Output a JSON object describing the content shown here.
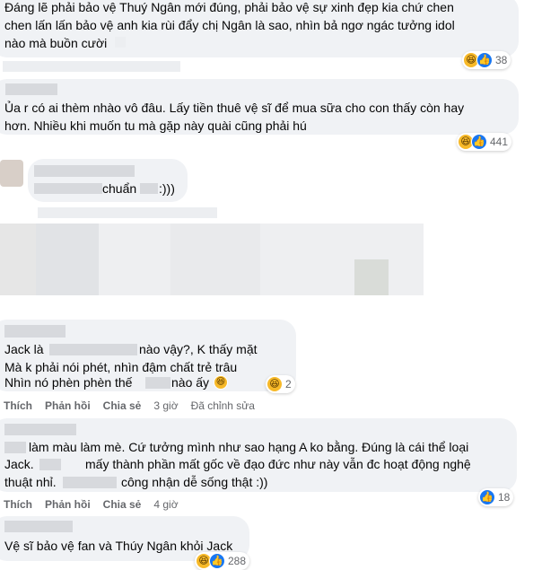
{
  "comments": [
    {
      "lines": [
        "Đáng lẽ phải bảo vệ Thuý Ngân mới đúng, phải bảo vệ sự xinh đẹp kia chứ chen",
        "chen lấn lấn bảo vệ anh kia rùi đẩy chị Ngân là sao, nhìn bả ngơ ngác tưởng idol",
        "nào mà buồn cười"
      ],
      "reaction_count": "38"
    },
    {
      "lines": [
        "Ủa r có ai thèm nhào vô đâu. Lấy tiền thuê vệ sĩ để mua sữa cho con thấy còn hay",
        "hơn. Nhiều khi muốn tu mà gặp này quài cũng phải hú"
      ],
      "reaction_count": "441"
    },
    {
      "lines": [
        "chuẩn",
        ":)))"
      ]
    },
    {
      "lines": [
        "Jack là",
        "nào vậy?, K thấy mặt",
        "Mà k phải nói phét, nhìn đậm chất trẻ trâu",
        "Nhìn nó phèn phèn thế",
        "nào ấy"
      ],
      "reaction_count": "2",
      "actions": {
        "like": "Thích",
        "reply": "Phản hồi",
        "share": "Chia sẻ",
        "time": "3 giờ",
        "edited": "Đã chỉnh sửa"
      }
    },
    {
      "lines": [
        "làm màu làm mè. Cứ tưởng mình như sao hạng A ko bằng. Đúng là cái thể loại",
        "Jack.",
        "mấy thành phần mất gốc về đạo đức như này vẫn đc hoạt động nghệ",
        "thuật nhỉ.",
        "công nhận dễ sống thật :))"
      ],
      "reaction_count": "18",
      "actions": {
        "like": "Thích",
        "reply": "Phản hồi",
        "share": "Chia sẻ",
        "time": "4 giờ"
      }
    },
    {
      "lines": [
        "Vệ sĩ bảo vệ fan và Thúy Ngân khỏi Jack"
      ],
      "reaction_count": "288"
    }
  ],
  "icons": {
    "haha": "haha-emoji-icon",
    "like": "thumbs-up-icon"
  },
  "colors": {
    "bubble": "#f0f2f5",
    "like_blue": "#1877f2",
    "haha_yellow": "#f7b928",
    "meta_gray": "#65676b"
  }
}
